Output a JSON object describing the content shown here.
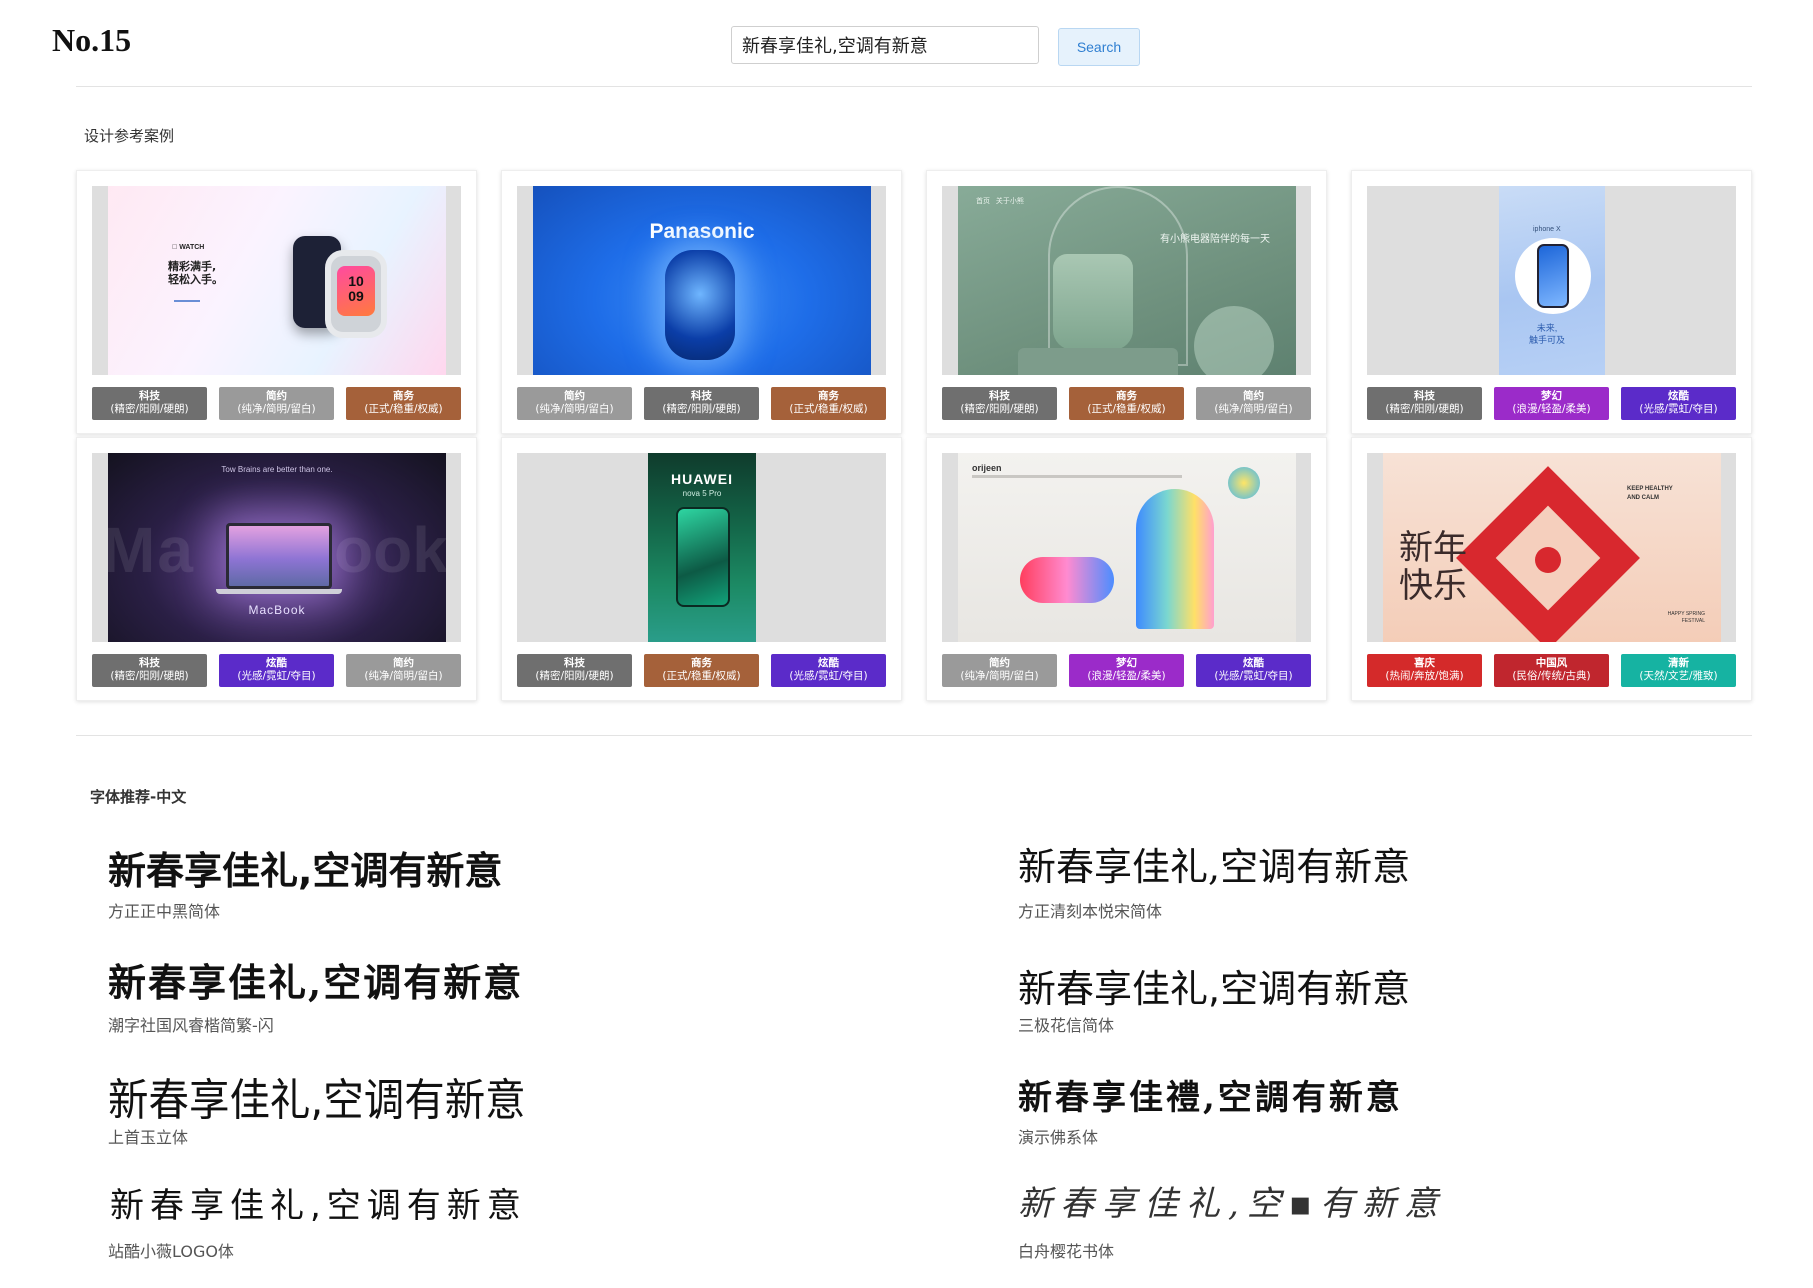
{
  "header": {
    "page_number": "No.15",
    "search_value": "新春享佳礼,空调有新意",
    "search_button": "Search"
  },
  "section_cases": {
    "title": "设计参考案例"
  },
  "cards": [
    {
      "name": "apple-watch",
      "texts": [
        "WATCH",
        "精彩满手,",
        "轻松入手。",
        "10",
        "09"
      ],
      "tags": [
        {
          "title": "科技",
          "sub": "(精密/阳刚/硬朗)",
          "color": "#6f6f6f"
        },
        {
          "title": "简约",
          "sub": "(纯净/简明/留白)",
          "color": "#9a9a9a"
        },
        {
          "title": "商务",
          "sub": "(正式/稳重/权威)",
          "color": "#a5613a"
        }
      ]
    },
    {
      "name": "panasonic",
      "texts": [
        "Panasonic"
      ],
      "tags": [
        {
          "title": "简约",
          "sub": "(纯净/简明/留白)",
          "color": "#9a9a9a"
        },
        {
          "title": "科技",
          "sub": "(精密/阳刚/硬朗)",
          "color": "#6f6f6f"
        },
        {
          "title": "商务",
          "sub": "(正式/稳重/权威)",
          "color": "#a5613a"
        }
      ]
    },
    {
      "name": "humidifier",
      "texts": [
        "首页",
        "关于小熊",
        "有小熊电器陪伴的每一天"
      ],
      "tags": [
        {
          "title": "科技",
          "sub": "(精密/阳刚/硬朗)",
          "color": "#6f6f6f"
        },
        {
          "title": "商务",
          "sub": "(正式/稳重/权威)",
          "color": "#a5613a"
        },
        {
          "title": "简约",
          "sub": "(纯净/简明/留白)",
          "color": "#9a9a9a"
        }
      ]
    },
    {
      "name": "iphone-x",
      "texts": [
        "iphone X",
        "未来,",
        "触手可及"
      ],
      "tags": [
        {
          "title": "科技",
          "sub": "(精密/阳刚/硬朗)",
          "color": "#6f6f6f"
        },
        {
          "title": "梦幻",
          "sub": "(浪漫/轻盈/柔美)",
          "color": "#9b2bc9"
        },
        {
          "title": "炫酷",
          "sub": "(光感/霓虹/夺目)",
          "color": "#5b2bc9"
        }
      ]
    },
    {
      "name": "macbook",
      "texts": [
        "Tow Brains are better than one.",
        "MacBook",
        "Ma",
        "ook"
      ],
      "tags": [
        {
          "title": "科技",
          "sub": "(精密/阳刚/硬朗)",
          "color": "#6f6f6f"
        },
        {
          "title": "炫酷",
          "sub": "(光感/霓虹/夺目)",
          "color": "#5b2bc9"
        },
        {
          "title": "简约",
          "sub": "(纯净/简明/留白)",
          "color": "#9a9a9a"
        }
      ]
    },
    {
      "name": "huawei",
      "texts": [
        "HUAWEI",
        "nova 5 Pro"
      ],
      "tags": [
        {
          "title": "科技",
          "sub": "(精密/阳刚/硬朗)",
          "color": "#6f6f6f"
        },
        {
          "title": "商务",
          "sub": "(正式/稳重/权威)",
          "color": "#a5613a"
        },
        {
          "title": "炫酷",
          "sub": "(光感/霓虹/夺目)",
          "color": "#5b2bc9"
        }
      ]
    },
    {
      "name": "orijeen",
      "texts": [
        "orijeen"
      ],
      "tags": [
        {
          "title": "简约",
          "sub": "(纯净/简明/留白)",
          "color": "#9a9a9a"
        },
        {
          "title": "梦幻",
          "sub": "(浪漫/轻盈/柔美)",
          "color": "#9b2bc9"
        },
        {
          "title": "炫酷",
          "sub": "(光感/霓虹/夺目)",
          "color": "#5b2bc9"
        }
      ]
    },
    {
      "name": "new-year",
      "texts": [
        "新年",
        "快乐",
        "KEEP HEALTHY AND CALM",
        "HAPPY SPRING FESTIVAL"
      ],
      "tags": [
        {
          "title": "喜庆",
          "sub": "(热闹/奔放/饱满)",
          "color": "#d42a2a"
        },
        {
          "title": "中国风",
          "sub": "(民俗/传统/古典)",
          "color": "#c0262e"
        },
        {
          "title": "清新",
          "sub": "(天然/文艺/雅致)",
          "color": "#16b3a2"
        }
      ]
    }
  ],
  "section_fonts": {
    "title": "字体推荐-中文"
  },
  "fonts": [
    {
      "sample": "新春享佳礼,空调有新意",
      "name": "方正正中黑简体"
    },
    {
      "sample": "新春享佳礼,空调有新意",
      "name": "方正清刻本悦宋简体"
    },
    {
      "sample": "新春享佳礼,空调有新意",
      "name": "潮字社国风睿楷简繁-闪"
    },
    {
      "sample": "新春享佳礼,空调有新意",
      "name": "三极花信简体"
    },
    {
      "sample": "新春享佳礼,空调有新意",
      "name": "上首玉立体"
    },
    {
      "sample": "新春享佳禮,空調有新意",
      "name": "演示佛系体"
    },
    {
      "sample": "新春享佳礼,空调有新意",
      "name": "站酷小薇LOGO体"
    },
    {
      "sample": "新春享佳礼,空▪有新意",
      "name": "白舟樱花书体"
    }
  ]
}
